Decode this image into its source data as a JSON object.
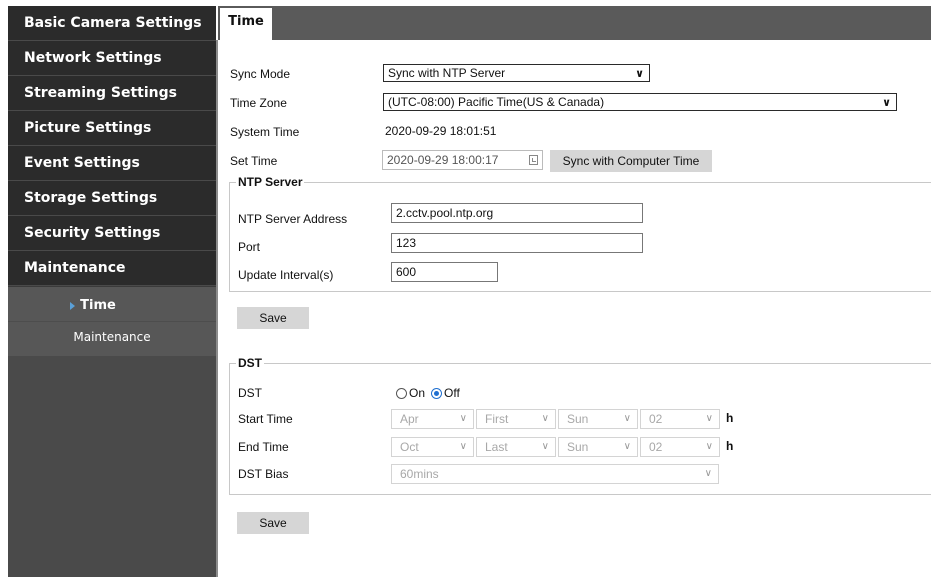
{
  "sidebar": {
    "menu": [
      {
        "label": "Basic Camera Settings"
      },
      {
        "label": "Network Settings"
      },
      {
        "label": "Streaming Settings"
      },
      {
        "label": "Picture Settings"
      },
      {
        "label": "Event Settings"
      },
      {
        "label": "Storage Settings"
      },
      {
        "label": "Security Settings"
      },
      {
        "label": "Maintenance"
      }
    ],
    "submenu": [
      {
        "label": "Time",
        "active": true
      },
      {
        "label": "Maintenance",
        "active": false
      }
    ]
  },
  "tabs": [
    {
      "label": "Time"
    }
  ],
  "time": {
    "sync_mode_label": "Sync Mode",
    "sync_mode_value": "Sync with NTP Server",
    "time_zone_label": "Time Zone",
    "time_zone_value": "(UTC-08:00) Pacific Time(US & Canada)",
    "system_time_label": "System Time",
    "system_time_value": "2020-09-29 18:01:51",
    "set_time_label": "Set Time",
    "set_time_value": "2020-09-29 18:00:17",
    "sync_computer_button": "Sync with Computer Time"
  },
  "ntp": {
    "legend": "NTP Server",
    "address_label": "NTP Server Address",
    "address_value": "2.cctv.pool.ntp.org",
    "port_label": "Port",
    "port_value": "123",
    "interval_label": "Update Interval(s)",
    "interval_value": "600",
    "save_button": "Save"
  },
  "dst": {
    "legend": "DST",
    "dst_label": "DST",
    "on_label": "On",
    "off_label": "Off",
    "selected": "Off",
    "start_label": "Start Time",
    "start": {
      "month": "Apr",
      "week": "First",
      "day": "Sun",
      "hour": "02",
      "unit": "h"
    },
    "end_label": "End Time",
    "end": {
      "month": "Oct",
      "week": "Last",
      "day": "Sun",
      "hour": "02",
      "unit": "h"
    },
    "bias_label": "DST Bias",
    "bias_value": "60mins",
    "save_button": "Save"
  },
  "colors": {
    "sidebar_bg": "#2b2b2b",
    "submenu_bg": "#575757",
    "topbar_bg": "#5a5a5a",
    "radio_selected": "#1f6fd0",
    "submenu_caret": "#5aa0d8"
  }
}
